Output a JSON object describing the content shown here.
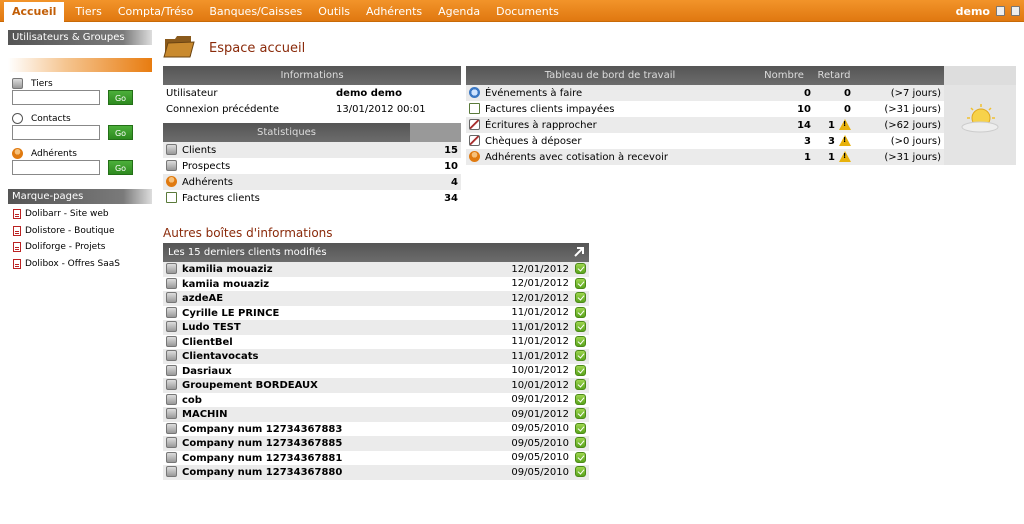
{
  "topmenu": {
    "items": [
      "Accueil",
      "Tiers",
      "Compta/Tréso",
      "Banques/Caisses",
      "Outils",
      "Adhérents",
      "Agenda",
      "Documents"
    ],
    "user": "demo"
  },
  "sidebar": {
    "users_groups": "Utilisateurs & Groupes",
    "search": [
      {
        "label": "Tiers",
        "button": "Go"
      },
      {
        "label": "Contacts",
        "button": "Go"
      },
      {
        "label": "Adhérents",
        "button": "Go"
      }
    ],
    "bookmarks_title": "Marque-pages",
    "bookmarks": [
      "Dolibarr - Site web",
      "Dolistore - Boutique",
      "Doliforge - Projets",
      "Dolibox - Offres SaaS"
    ]
  },
  "page_title": "Espace accueil",
  "informations": {
    "title": "Informations",
    "rows": [
      {
        "label": "Utilisateur",
        "value": "demo demo"
      },
      {
        "label": "Connexion précédente",
        "value": "13/01/2012 00:01"
      }
    ]
  },
  "statistiques": {
    "title": "Statistiques",
    "rows": [
      {
        "label": "Clients",
        "value": "15"
      },
      {
        "label": "Prospects",
        "value": "10"
      },
      {
        "label": "Adhérents",
        "value": "4"
      },
      {
        "label": "Factures clients",
        "value": "34"
      }
    ]
  },
  "dashboard": {
    "title": "Tableau de bord de travail",
    "col_nombre": "Nombre",
    "col_retard": "Retard",
    "rows": [
      {
        "label": "Événements à faire",
        "nombre": "0",
        "retard": "0",
        "delay": "(>7 jours)",
        "warn": false
      },
      {
        "label": "Factures clients impayées",
        "nombre": "10",
        "retard": "0",
        "delay": "(>31 jours)",
        "warn": false
      },
      {
        "label": "Écritures à rapprocher",
        "nombre": "14",
        "retard": "1",
        "delay": "(>62 jours)",
        "warn": true
      },
      {
        "label": "Chèques à déposer",
        "nombre": "3",
        "retard": "3",
        "delay": "(>0 jours)",
        "warn": true
      },
      {
        "label": "Adhérents avec cotisation à recevoir",
        "nombre": "1",
        "retard": "1",
        "delay": "(>31 jours)",
        "warn": true
      }
    ]
  },
  "other_boxes_title": "Autres boîtes d'informations",
  "last_clients": {
    "title": "Les 15 derniers clients modifiés",
    "rows": [
      {
        "name": "kamilia mouaziz",
        "date": "12/01/2012"
      },
      {
        "name": "kamiia mouaziz",
        "date": "12/01/2012"
      },
      {
        "name": "azdeAE",
        "date": "12/01/2012"
      },
      {
        "name": "Cyrille LE PRINCE",
        "date": "11/01/2012"
      },
      {
        "name": "Ludo TEST",
        "date": "11/01/2012"
      },
      {
        "name": "ClientBel",
        "date": "11/01/2012"
      },
      {
        "name": "Clientavocats",
        "date": "11/01/2012"
      },
      {
        "name": "Dasriaux",
        "date": "10/01/2012"
      },
      {
        "name": "Groupement BORDEAUX",
        "date": "10/01/2012"
      },
      {
        "name": "cob",
        "date": "09/01/2012"
      },
      {
        "name": "MACHIN",
        "date": "09/01/2012"
      },
      {
        "name": "Company num 12734367883",
        "date": "09/05/2010"
      },
      {
        "name": "Company num 12734367885",
        "date": "09/05/2010"
      },
      {
        "name": "Company num 12734367881",
        "date": "09/05/2010"
      },
      {
        "name": "Company num 12734367880",
        "date": "09/05/2010"
      }
    ]
  }
}
